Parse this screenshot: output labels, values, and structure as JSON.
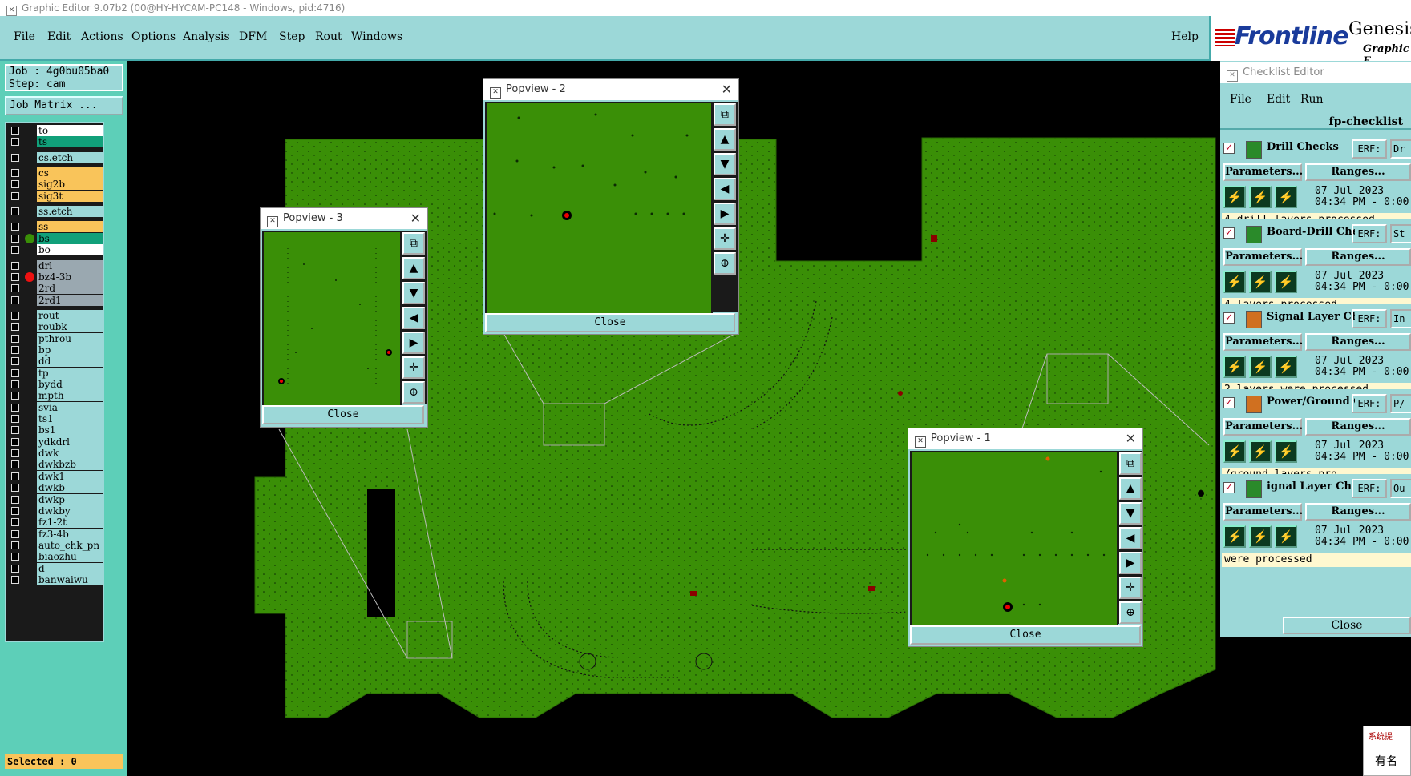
{
  "window_title": "Graphic Editor 9.07b2 (00@HY-HYCAM-PC148 - Windows, pid:4716)",
  "menu": [
    "File",
    "Edit",
    "Actions",
    "Options",
    "Analysis",
    "DFM",
    "Step",
    "Rout",
    "Windows"
  ],
  "help": "Help",
  "logo": {
    "brand": "Frontline",
    "product": "Genesis",
    "subtitle": "Graphic E"
  },
  "job": {
    "job_line": "Job : 4g0bu05ba0",
    "step_line": "Step: cam",
    "job_matrix_label": "Job Matrix ..."
  },
  "layers": [
    {
      "name": "to",
      "color": "#ffffff",
      "dot": ""
    },
    {
      "name": "ts",
      "color": "#11a07a",
      "dot": ""
    },
    {
      "name": "cs.etch",
      "color": "#9cd8d8",
      "dot": ""
    },
    {
      "name": "cs",
      "color": "#f9c45a",
      "dot": ""
    },
    {
      "name": "sig2b",
      "color": "#f9c45a",
      "dot": ""
    },
    {
      "name": "sig3t",
      "color": "#f9c45a",
      "dot": ""
    },
    {
      "name": "ss.etch",
      "color": "#9cd8d8",
      "dot": ""
    },
    {
      "name": "ss",
      "color": "#f9c45a",
      "dot": ""
    },
    {
      "name": "bs",
      "color": "#11a07a",
      "dot": "#3a8f07"
    },
    {
      "name": "bo",
      "color": "#ffffff",
      "dot": ""
    },
    {
      "name": "drl",
      "color": "#9aa8b0",
      "dot": ""
    },
    {
      "name": "bz4-3b",
      "color": "#9aa8b0",
      "dot": "#ee1111"
    },
    {
      "name": "2rd",
      "color": "#9aa8b0",
      "dot": ""
    },
    {
      "name": "2rd1",
      "color": "#9aa8b0",
      "dot": ""
    },
    {
      "name": "rout",
      "color": "#9cd8d8",
      "dot": ""
    },
    {
      "name": "roubk",
      "color": "#9cd8d8",
      "dot": ""
    },
    {
      "name": "pthrou",
      "color": "#9cd8d8",
      "dot": ""
    },
    {
      "name": "bp",
      "color": "#9cd8d8",
      "dot": ""
    },
    {
      "name": "dd",
      "color": "#9cd8d8",
      "dot": ""
    },
    {
      "name": "tp",
      "color": "#9cd8d8",
      "dot": ""
    },
    {
      "name": "bydd",
      "color": "#9cd8d8",
      "dot": ""
    },
    {
      "name": "mpth",
      "color": "#9cd8d8",
      "dot": ""
    },
    {
      "name": "svia",
      "color": "#9cd8d8",
      "dot": ""
    },
    {
      "name": "ts1",
      "color": "#9cd8d8",
      "dot": ""
    },
    {
      "name": "bs1",
      "color": "#9cd8d8",
      "dot": ""
    },
    {
      "name": "ydkdrl",
      "color": "#9cd8d8",
      "dot": ""
    },
    {
      "name": "dwk",
      "color": "#9cd8d8",
      "dot": ""
    },
    {
      "name": "dwkbzb",
      "color": "#9cd8d8",
      "dot": ""
    },
    {
      "name": "dwk1",
      "color": "#9cd8d8",
      "dot": ""
    },
    {
      "name": "dwkb",
      "color": "#9cd8d8",
      "dot": ""
    },
    {
      "name": "dwkp",
      "color": "#9cd8d8",
      "dot": ""
    },
    {
      "name": "dwkby",
      "color": "#9cd8d8",
      "dot": ""
    },
    {
      "name": "fz1-2t",
      "color": "#9cd8d8",
      "dot": ""
    },
    {
      "name": "fz3-4b",
      "color": "#9cd8d8",
      "dot": ""
    },
    {
      "name": "auto_chk_pn",
      "color": "#9cd8d8",
      "dot": ""
    },
    {
      "name": "biaozhu",
      "color": "#9cd8d8",
      "dot": ""
    },
    {
      "name": "d",
      "color": "#9cd8d8",
      "dot": ""
    },
    {
      "name": "banwaiwu",
      "color": "#9cd8d8",
      "dot": ""
    }
  ],
  "selected_text": "Selected : 0",
  "popviews": {
    "p2": {
      "title": "Popview - 2",
      "close": "Close"
    },
    "p3": {
      "title": "Popview - 3",
      "close": "Close"
    },
    "p1": {
      "title": "Popview - 1",
      "close": "Close"
    }
  },
  "checklist": {
    "title": "Checklist Editor",
    "menu": [
      "File",
      "Edit",
      "Run"
    ],
    "name": "fp-checklist",
    "parameters_label": "Parameters...",
    "ranges_label": "Ranges...",
    "erf_label": "ERF:",
    "close": "Close",
    "actions": [
      {
        "name": "Drill Checks",
        "erf_value": "Dr",
        "date": "07 Jul 2023",
        "time": "04:34 PM - 0:00",
        "status": "4 drill layers processed"
      },
      {
        "name": "Board-Drill Che",
        "erf_value": "St",
        "date": "07 Jul 2023",
        "time": "04:34 PM - 0:00",
        "status": "4 layers processed"
      },
      {
        "name": "Signal Layer Ch",
        "erf_value": "In",
        "date": "07 Jul 2023",
        "time": "04:34 PM - 0:00",
        "status": "2 layers were processed"
      },
      {
        "name": "Power/Ground C",
        "erf_value": "P/",
        "date": "07 Jul 2023",
        "time": "04:34 PM - 0:00",
        "status": "/ground layers pro"
      },
      {
        "name": "ignal Layer Ch",
        "erf_value": "Ou",
        "date": "07 Jul 2023",
        "time": "04:34 PM - 0:00",
        "status": " were processed"
      }
    ]
  },
  "notification": {
    "line1": "系统提",
    "line2": "有名"
  }
}
